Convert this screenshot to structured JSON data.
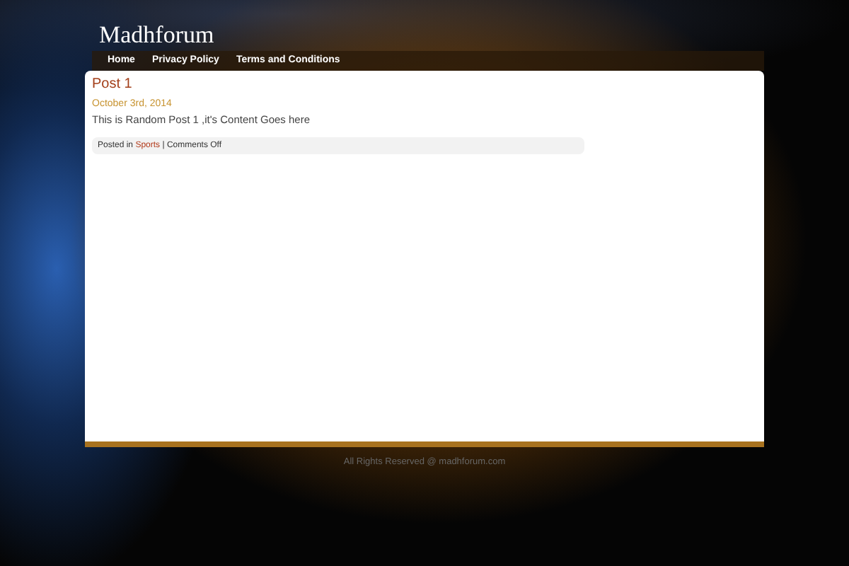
{
  "site": {
    "title": "Madhforum"
  },
  "nav": [
    {
      "label": "Home"
    },
    {
      "label": "Privacy Policy"
    },
    {
      "label": "Terms and Conditions"
    }
  ],
  "post": {
    "title": "Post 1",
    "date": "October 3rd, 2014",
    "body": "This is Random Post 1 ,it's Content Goes here",
    "meta": {
      "prefix": "Posted in",
      "category": "Sports",
      "suffix": "| Comments Off"
    }
  },
  "footer": {
    "text": "All Rights Reserved @ madhforum.com"
  }
}
